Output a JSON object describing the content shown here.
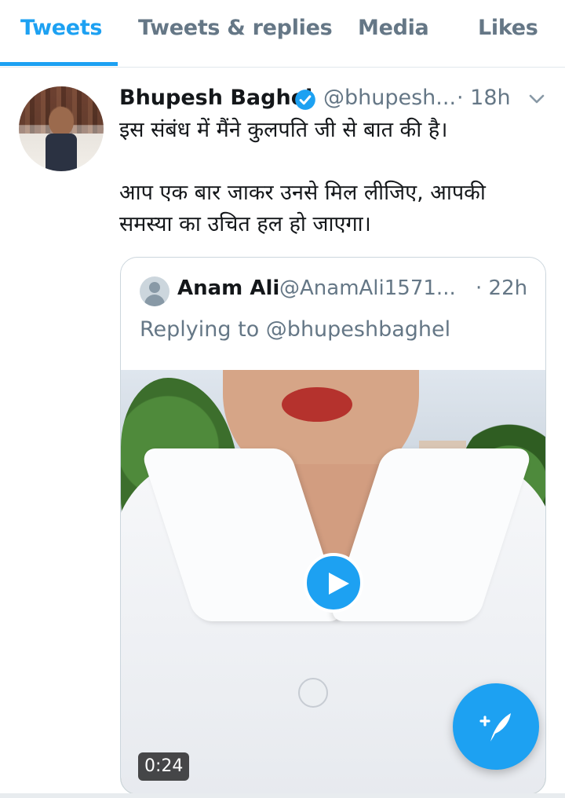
{
  "tabs": [
    {
      "label": "Tweets",
      "active": true
    },
    {
      "label": "Tweets & replies",
      "active": false
    },
    {
      "label": "Media",
      "active": false
    },
    {
      "label": "Likes",
      "active": false
    }
  ],
  "tweet": {
    "author": "Bhupesh Baghel",
    "verified": true,
    "handle": "@bhupesh...",
    "time": "· 18h",
    "text_line1": "इस संबंध में मैंने कुलपति जी से बात की है।",
    "text_line2": "आप एक बार जाकर उनसे मिल लीजिए, आपकी",
    "text_line3": "समस्या का उचित हल हो जाएगा।"
  },
  "quoted": {
    "name": "Anam Ali",
    "handle": "@AnamAli1571...",
    "time": "· 22h",
    "replying_to": "Replying to @bhupeshbaghel",
    "video_duration": "0:24"
  },
  "icons": {
    "verified": "verified-badge-icon",
    "menu": "chevron-down-icon",
    "play": "play-icon",
    "compose": "compose-tweet-icon"
  },
  "colors": {
    "accent": "#1da1f2",
    "secondary_text": "#657786",
    "primary_text": "#14171a",
    "border": "#ccd6dd"
  }
}
